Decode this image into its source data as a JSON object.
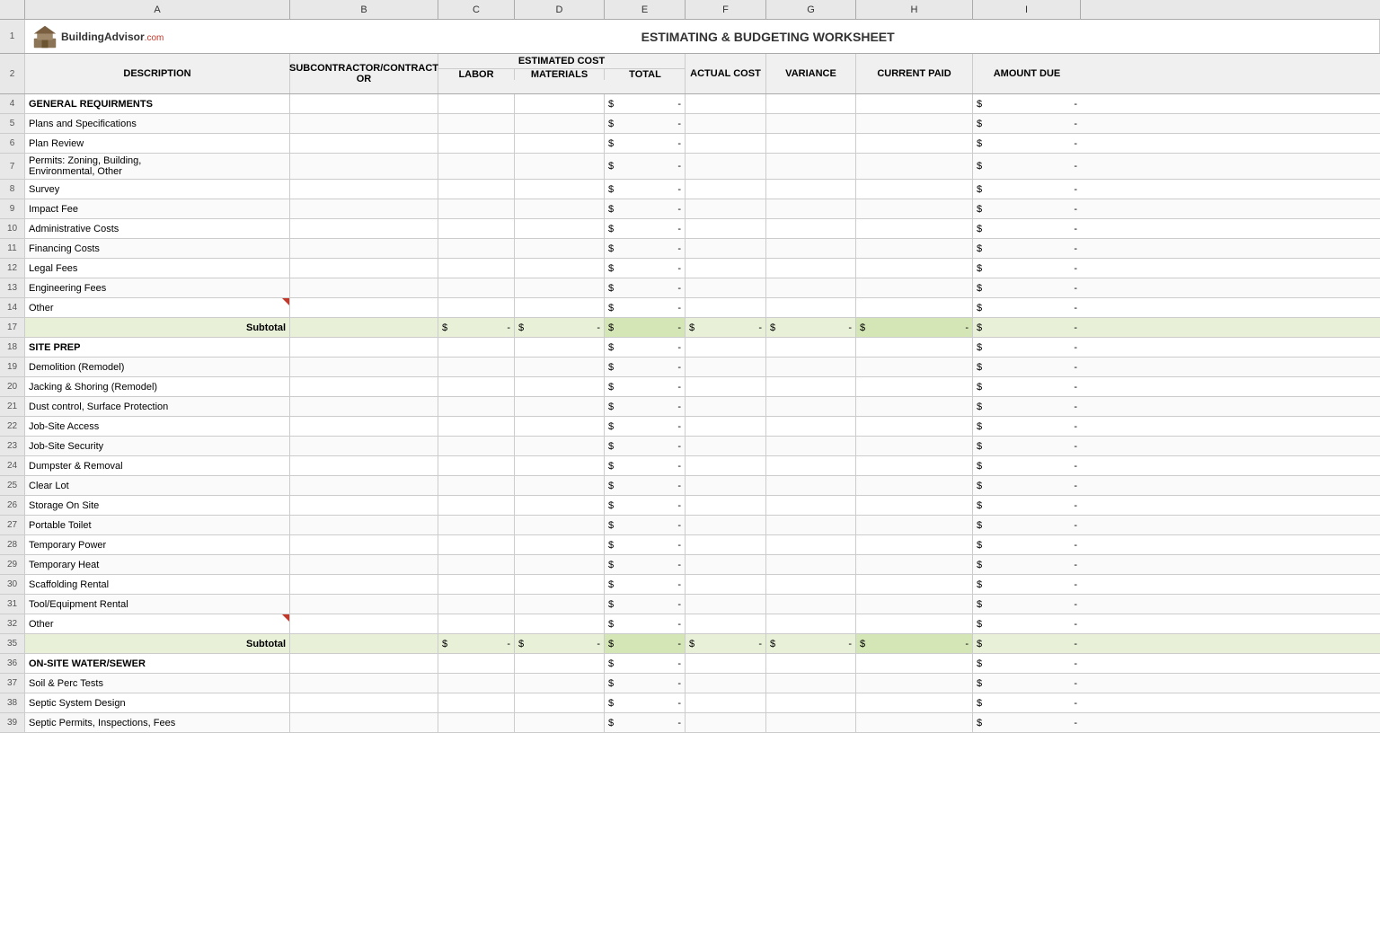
{
  "app": {
    "title": "ESTIMATING & BUDGETING WORKSHEET",
    "logo_text": "BuildingAdvisor",
    "logo_suffix": ".com"
  },
  "columns": {
    "row_num": "#",
    "a": "A",
    "b": "B",
    "c": "C",
    "d": "D",
    "e": "E",
    "f": "F",
    "g": "G",
    "h": "H",
    "i": "I"
  },
  "headers": {
    "description": "DESCRIPTION",
    "subcontractor": "SUBCONTRACTOR/CONTRACT OR",
    "estimated_cost": "ESTIMATED COST",
    "labor": "LABOR",
    "materials": "MATERIALS",
    "total": "TOTAL",
    "actual_cost": "ACTUAL COST",
    "variance": "VARIANCE",
    "current_paid": "CURRENT PAID",
    "amount_due": "AMOUNT DUE"
  },
  "rows": [
    {
      "num": "4",
      "desc": "GENERAL REQUIRMENTS",
      "bold": true,
      "section": true,
      "total": "$ -",
      "amount_due": "$ -"
    },
    {
      "num": "5",
      "desc": "Plans and Specifications",
      "total": "$ -",
      "amount_due": "$ -"
    },
    {
      "num": "6",
      "desc": "Plan Review",
      "total": "$ -",
      "amount_due": "$ -"
    },
    {
      "num": "7",
      "desc": "Permits: Zoning, Building,\nEnvironmental, Other",
      "multiline": true,
      "total": "$ -",
      "amount_due": "$ -"
    },
    {
      "num": "8",
      "desc": "Survey",
      "total": "$ -",
      "amount_due": "$ -"
    },
    {
      "num": "9",
      "desc": "Impact Fee",
      "total": "$ -",
      "amount_due": "$ -"
    },
    {
      "num": "10",
      "desc": "Administrative Costs",
      "total": "$ -",
      "amount_due": "$ -"
    },
    {
      "num": "11",
      "desc": "Financing Costs",
      "total": "$ -",
      "amount_due": "$ -"
    },
    {
      "num": "12",
      "desc": "Legal Fees",
      "total": "$ -",
      "amount_due": "$ -"
    },
    {
      "num": "13",
      "desc": "Engineering Fees",
      "total": "$ -",
      "amount_due": "$ -"
    },
    {
      "num": "14",
      "desc": "Other",
      "red_triangle": true,
      "total": "$ -",
      "amount_due": "$ -"
    },
    {
      "num": "17",
      "desc": "Subtotal",
      "subtotal": true,
      "labor": "$ -",
      "materials": "$ -",
      "total": "$ -",
      "actual": "$ -",
      "variance": "$ -",
      "current_paid": "$ -",
      "amount_due": "$ -"
    },
    {
      "num": "18",
      "desc": "SITE PREP",
      "bold": true,
      "section": true,
      "total": "$ -",
      "amount_due": "$ -"
    },
    {
      "num": "19",
      "desc": "Demolition (Remodel)",
      "total": "$ -",
      "amount_due": "$ -"
    },
    {
      "num": "20",
      "desc": "Jacking & Shoring (Remodel)",
      "total": "$ -",
      "amount_due": "$ -"
    },
    {
      "num": "21",
      "desc": "Dust control, Surface Protection",
      "total": "$ -",
      "amount_due": "$ -"
    },
    {
      "num": "22",
      "desc": "Job-Site Access",
      "total": "$ -",
      "amount_due": "$ -"
    },
    {
      "num": "23",
      "desc": "Job-Site Security",
      "total": "$ -",
      "amount_due": "$ -"
    },
    {
      "num": "24",
      "desc": "Dumpster & Removal",
      "total": "$ -",
      "amount_due": "$ -"
    },
    {
      "num": "25",
      "desc": "Clear Lot",
      "total": "$ -",
      "amount_due": "$ -"
    },
    {
      "num": "26",
      "desc": "Storage On Site",
      "total": "$ -",
      "amount_due": "$ -"
    },
    {
      "num": "27",
      "desc": "Portable Toilet",
      "total": "$ -",
      "amount_due": "$ -"
    },
    {
      "num": "28",
      "desc": "Temporary Power",
      "total": "$ -",
      "amount_due": "$ -"
    },
    {
      "num": "29",
      "desc": "Temporary Heat",
      "total": "$ -",
      "amount_due": "$ -"
    },
    {
      "num": "30",
      "desc": "Scaffolding Rental",
      "total": "$ -",
      "amount_due": "$ -"
    },
    {
      "num": "31",
      "desc": "Tool/Equipment Rental",
      "total": "$ -",
      "amount_due": "$ -"
    },
    {
      "num": "32",
      "desc": "Other",
      "red_triangle": true,
      "total": "$ -",
      "amount_due": "$ -"
    },
    {
      "num": "35",
      "desc": "Subtotal",
      "subtotal": true,
      "labor": "$ -",
      "materials": "$ -",
      "total": "$ -",
      "actual": "$ -",
      "variance": "$ -",
      "current_paid": "$ -",
      "amount_due": "$ -"
    },
    {
      "num": "36",
      "desc": "ON-SITE WATER/SEWER",
      "bold": true,
      "section": true,
      "total": "$ -",
      "amount_due": "$ -"
    },
    {
      "num": "37",
      "desc": "Soil & Perc Tests",
      "total": "$ -",
      "amount_due": "$ -"
    },
    {
      "num": "38",
      "desc": "Septic System Design",
      "total": "$ -",
      "amount_due": "$ -"
    },
    {
      "num": "39",
      "desc": "Septic Permits, Inspections, Fees",
      "total": "$ -",
      "amount_due": "$ -"
    }
  ]
}
